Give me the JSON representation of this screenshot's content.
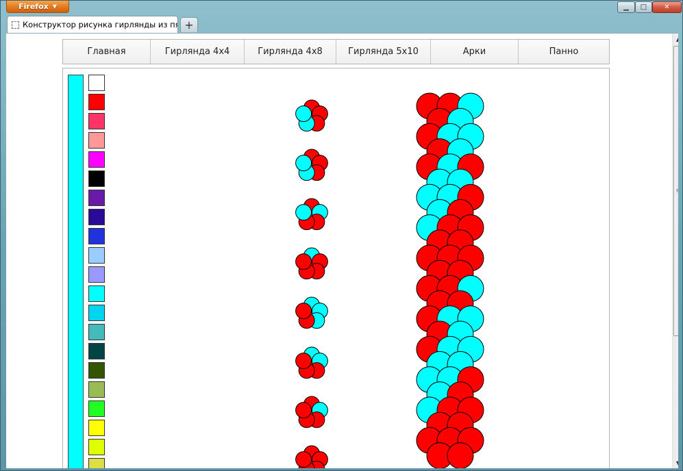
{
  "browser": {
    "menu_button_label": "Firefox",
    "tab_title": "Конструктор рисунка гирлянды из пят...",
    "new_tab_label": "+",
    "window_controls": {
      "minimize": "▁",
      "maximize": "□",
      "close": "✕"
    }
  },
  "nav": {
    "items": [
      {
        "label": "Главная"
      },
      {
        "label": "Гирлянда 4x4"
      },
      {
        "label": "Гирлянда 4x8"
      },
      {
        "label": "Гирлянда 5x10"
      },
      {
        "label": "Арки"
      },
      {
        "label": "Панно"
      }
    ]
  },
  "colors": {
    "red": "#ff0000",
    "cyan": "#00ffff",
    "selected": "#00ffff"
  },
  "palette": [
    "#ffffff",
    "#ff0000",
    "#ff3366",
    "#ff9999",
    "#ff00ff",
    "#000000",
    "#6a1aa8",
    "#2a0a99",
    "#2233dd",
    "#99ccff",
    "#9999ff",
    "#00ffff",
    "#00d5f0",
    "#44bbbb",
    "#004444",
    "#335500",
    "#99bb55",
    "#22ff22",
    "#ffff00",
    "#ddff00",
    "#dddd44"
  ],
  "flowers": [
    [
      "#ff0000",
      "#ff0000",
      "#ff0000",
      "#00ffff",
      "#00ffff"
    ],
    [
      "#ff0000",
      "#ff0000",
      "#ff0000",
      "#00ffff",
      "#00ffff"
    ],
    [
      "#ff0000",
      "#00ffff",
      "#ff0000",
      "#ff0000",
      "#00ffff"
    ],
    [
      "#00ffff",
      "#ff0000",
      "#ff0000",
      "#ff0000",
      "#ff0000"
    ],
    [
      "#00ffff",
      "#00ffff",
      "#00ffff",
      "#ff0000",
      "#ff0000"
    ],
    [
      "#00ffff",
      "#00ffff",
      "#ff0000",
      "#ff0000",
      "#ff0000"
    ],
    [
      "#ff0000",
      "#00ffff",
      "#ff0000",
      "#ff0000",
      "#ff0000"
    ],
    [
      "#ff0000",
      "#ff0000",
      "#ff0000",
      "#ff0000",
      "#ff0000"
    ]
  ],
  "garland_rows": [
    [
      "#ff0000",
      "#ff0000",
      "#00ffff"
    ],
    [
      "#ff0000",
      "#00ffff"
    ],
    [
      "#ff0000",
      "#00ffff",
      "#00ffff"
    ],
    [
      "#ff0000",
      "#00ffff"
    ],
    [
      "#ff0000",
      "#00ffff",
      "#ff0000"
    ],
    [
      "#00ffff",
      "#00ffff"
    ],
    [
      "#00ffff",
      "#00ffff",
      "#ff0000"
    ],
    [
      "#00ffff",
      "#ff0000"
    ],
    [
      "#00ffff",
      "#ff0000",
      "#ff0000"
    ],
    [
      "#ff0000",
      "#ff0000"
    ],
    [
      "#ff0000",
      "#ff0000",
      "#ff0000"
    ],
    [
      "#ff0000",
      "#ff0000"
    ],
    [
      "#ff0000",
      "#ff0000",
      "#00ffff"
    ],
    [
      "#ff0000",
      "#ff0000"
    ],
    [
      "#ff0000",
      "#00ffff",
      "#00ffff"
    ],
    [
      "#ff0000",
      "#00ffff"
    ],
    [
      "#ff0000",
      "#00ffff",
      "#00ffff"
    ],
    [
      "#00ffff",
      "#00ffff"
    ],
    [
      "#00ffff",
      "#00ffff",
      "#ff0000"
    ],
    [
      "#00ffff",
      "#ff0000"
    ],
    [
      "#00ffff",
      "#ff0000",
      "#ff0000"
    ],
    [
      "#ff0000",
      "#ff0000"
    ],
    [
      "#ff0000",
      "#ff0000",
      "#ff0000"
    ],
    [
      "#ff0000",
      "#ff0000"
    ]
  ]
}
